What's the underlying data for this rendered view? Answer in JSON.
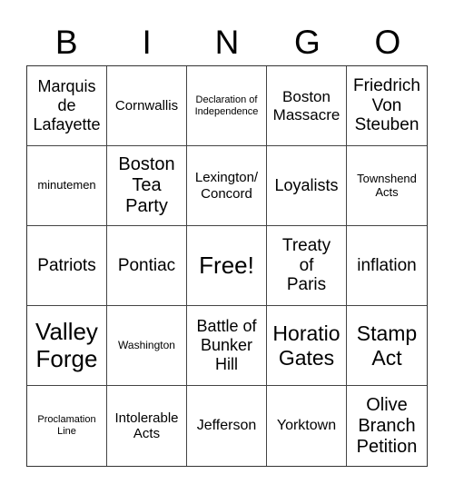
{
  "header": {
    "letters": [
      "B",
      "I",
      "N",
      "G",
      "O"
    ]
  },
  "cells": [
    {
      "text": "Marquis de Lafayette",
      "lines": [
        "Marquis",
        "de",
        "Lafayette"
      ],
      "size": "s18"
    },
    {
      "text": "Cornwallis",
      "lines": [
        "Cornwallis"
      ],
      "size": "s15"
    },
    {
      "text": "Declaration of Independence",
      "lines": [
        "Declaration of",
        "Independence"
      ],
      "size": "s9"
    },
    {
      "text": "Boston Massacre",
      "lines": [
        "Boston",
        "Massacre"
      ],
      "size": "s17"
    },
    {
      "text": "Friedrich Von Steuben",
      "lines": [
        "Friedrich",
        "Von",
        "Steuben"
      ],
      "size": "s19"
    },
    {
      "text": "minutemen",
      "lines": [
        "minutemen"
      ],
      "size": "s13"
    },
    {
      "text": "Boston Tea Party",
      "lines": [
        "Boston",
        "Tea",
        "Party"
      ],
      "size": "s20"
    },
    {
      "text": "Lexington/ Concord",
      "lines": [
        "Lexington/",
        "Concord"
      ],
      "size": "s15"
    },
    {
      "text": "Loyalists",
      "lines": [
        "Loyalists"
      ],
      "size": "s18"
    },
    {
      "text": "Townshend Acts",
      "lines": [
        "Townshend",
        "Acts"
      ],
      "size": "s13"
    },
    {
      "text": "Patriots",
      "lines": [
        "Patriots"
      ],
      "size": "s19"
    },
    {
      "text": "Pontiac",
      "lines": [
        "Pontiac"
      ],
      "size": "s19"
    },
    {
      "text": "Free!",
      "lines": [
        "Free!"
      ],
      "size": "s26"
    },
    {
      "text": "Treaty of Paris",
      "lines": [
        "Treaty",
        "of",
        "Paris"
      ],
      "size": "s19"
    },
    {
      "text": "inflation",
      "lines": [
        "inflation"
      ],
      "size": "s19"
    },
    {
      "text": "Valley Forge",
      "lines": [
        "Valley",
        "Forge"
      ],
      "size": "s26"
    },
    {
      "text": "Washington",
      "lines": [
        "Washington"
      ],
      "size": "s12"
    },
    {
      "text": "Battle of Bunker Hill",
      "lines": [
        "Battle of",
        "Bunker",
        "Hill"
      ],
      "size": "s18"
    },
    {
      "text": "Horatio Gates",
      "lines": [
        "Horatio",
        "Gates"
      ],
      "size": "s23"
    },
    {
      "text": "Stamp Act",
      "lines": [
        "Stamp",
        "Act"
      ],
      "size": "s23"
    },
    {
      "text": "Proclamation Line",
      "lines": [
        "Proclamation",
        "Line"
      ],
      "size": "s9"
    },
    {
      "text": "Intolerable Acts",
      "lines": [
        "Intolerable",
        "Acts"
      ],
      "size": "s15"
    },
    {
      "text": "Jefferson",
      "lines": [
        "Jefferson"
      ],
      "size": "s16"
    },
    {
      "text": "Yorktown",
      "lines": [
        "Yorktown"
      ],
      "size": "s16"
    },
    {
      "text": "Olive Branch Petition",
      "lines": [
        "Olive",
        "Branch",
        "Petition"
      ],
      "size": "s20"
    }
  ]
}
